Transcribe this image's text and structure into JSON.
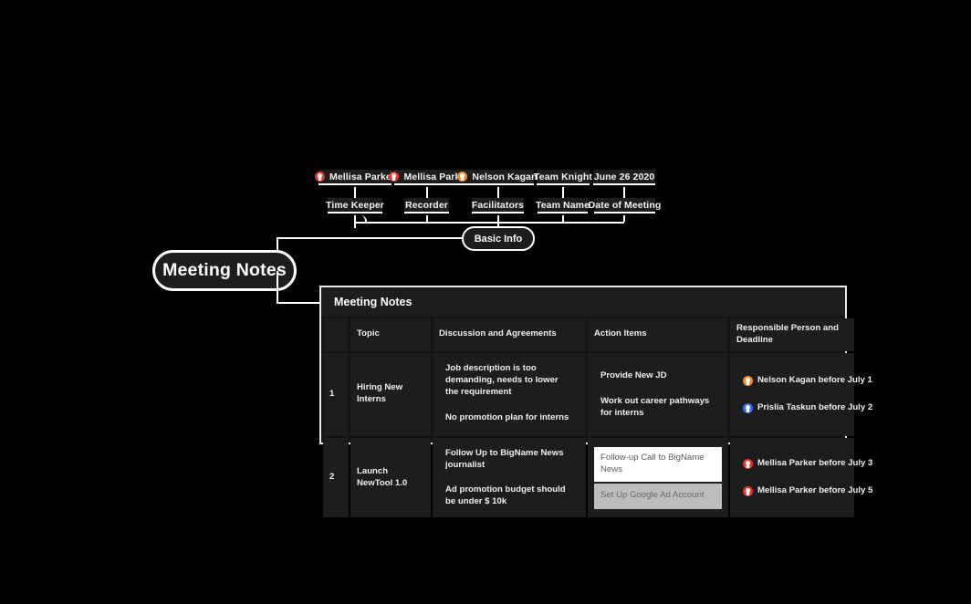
{
  "colors": {
    "background": "#000000",
    "node_fill": "#1d1d1d",
    "stroke": "#ffffff",
    "index_cell": "#3a3a3a",
    "avatar_red": "#e8352e",
    "avatar_orange": "#f08a26",
    "avatar_blue": "#2a73e8",
    "inverted_white": "#ffffff",
    "inverted_grey": "#bdbdbd"
  },
  "root": {
    "label": "Meeting Notes"
  },
  "branches": {
    "basic_info": {
      "label": "Basic Info",
      "children": [
        {
          "label": "Time Keeper",
          "value": "Mellisa Parker",
          "avatar": "avatar-icon",
          "avatar_color": "#e8352e"
        },
        {
          "label": "Recorder",
          "value": "Mellisa Parker",
          "avatar": "avatar-icon",
          "avatar_color": "#e8352e"
        },
        {
          "label": "Facilitators",
          "value": "Nelson Kagan",
          "avatar": "avatar-icon",
          "avatar_color": "#f08a26"
        },
        {
          "label": "Team Name",
          "value": "Team Knight",
          "avatar": null,
          "avatar_color": null
        },
        {
          "label": "Date of Meeting",
          "value": "June 26 2020",
          "avatar": null,
          "avatar_color": null
        }
      ]
    }
  },
  "notes_panel": {
    "title": "Meeting Notes",
    "columns": [
      "",
      "Topic",
      "Discussion and Agreements",
      "Action Items",
      "Responsible Person and Deadline"
    ],
    "rows": [
      {
        "index": "1",
        "topic": "Hiring New Interns",
        "lines": [
          {
            "discussion": "Job description is too demanding, needs to lower the requirement",
            "action": "Provide New JD",
            "action_state": "normal",
            "responsible": "Nelson Kagan before July 1",
            "avatar": "avatar-icon",
            "avatar_color": "#f08a26"
          },
          {
            "discussion": "No promotion plan for interns",
            "action": "Work out career pathways for interns",
            "action_state": "normal",
            "responsible": "Prislia Taskun before July 2",
            "avatar": "avatar-icon",
            "avatar_color": "#2a73e8"
          }
        ]
      },
      {
        "index": "2",
        "topic": "Launch NewTool 1.0",
        "lines": [
          {
            "discussion": "Follow Up to BigName News journalist",
            "action": "Follow-up Call to BigName News",
            "action_state": "inverted-white",
            "responsible": "Mellisa Parker before July 3",
            "avatar": "avatar-icon",
            "avatar_color": "#e8352e"
          },
          {
            "discussion": "Ad promotion budget should be under $ 10k",
            "action": "Set Up Google Ad Account",
            "action_state": "inverted-grey",
            "responsible": "Mellisa Parker before July 5",
            "avatar": "avatar-icon",
            "avatar_color": "#e8352e"
          }
        ]
      }
    ]
  }
}
